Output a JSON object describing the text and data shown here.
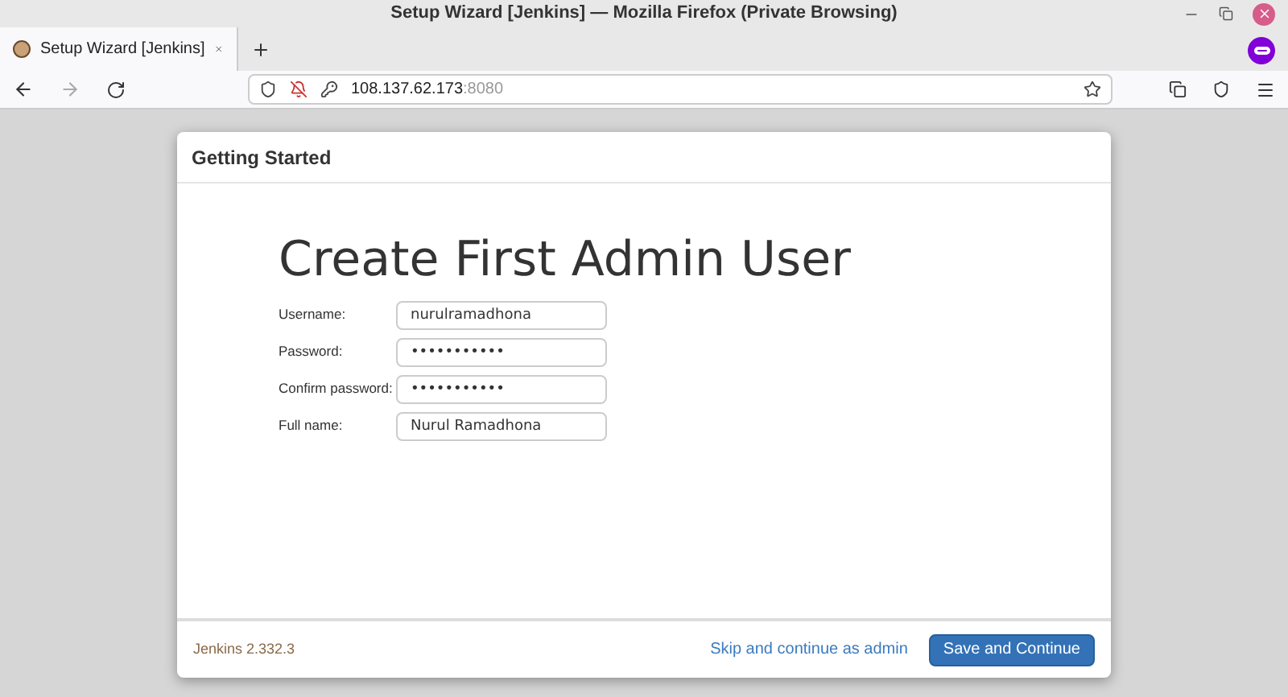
{
  "window": {
    "title": "Setup Wizard [Jenkins] — Mozilla Firefox (Private Browsing)"
  },
  "tabs": [
    {
      "label": "Setup Wizard [Jenkins]",
      "selected": true
    }
  ],
  "address_bar": {
    "host": "108.137.62.173",
    "port": ":8080"
  },
  "dialog": {
    "header": "Getting Started",
    "heading": "Create First Admin User",
    "fields": [
      {
        "label": "Username:",
        "value": "nurulramadhona"
      },
      {
        "label": "Password:",
        "value": "•••••••••••"
      },
      {
        "label": "Confirm password:",
        "value": "•••••••••••"
      },
      {
        "label": "Full name:",
        "value": "Nurul Ramadhona"
      }
    ],
    "version": "Jenkins 2.332.3",
    "skip_link": "Skip and continue as admin",
    "primary_button": "Save and Continue"
  }
}
